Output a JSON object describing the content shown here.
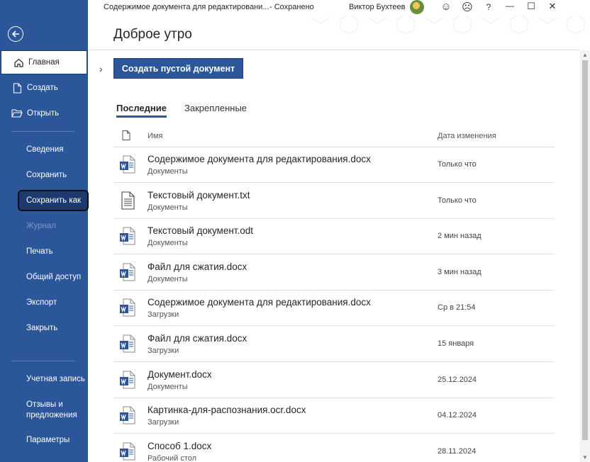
{
  "titlebar": {
    "document_title": "Содержимое документа для редактировани...",
    "status": "-  Сохранено",
    "user_name": "Виктор Бухтеев",
    "icons": [
      "smile-icon",
      "frown-icon",
      "help-icon",
      "minimize-icon",
      "maximize-icon",
      "close-icon"
    ],
    "icon_glyphs": {
      "smile": "☺",
      "frown": "☹",
      "help": "?",
      "minimize": "—",
      "maximize": "☐",
      "close": "✕"
    }
  },
  "greeting": "Доброе утро",
  "sidebar": {
    "back_icon": "back-arrow-icon",
    "home": "Главная",
    "create": "Создать",
    "open": "Открыть",
    "info": "Сведения",
    "save": "Сохранить",
    "save_as": "Сохранить как",
    "history": "Журнал",
    "print": "Печать",
    "share": "Общий доступ",
    "export": "Экспорт",
    "close": "Закрыть",
    "account": "Учетная запись",
    "feedback_line1": "Отзывы и",
    "feedback_line2": "предложения",
    "options": "Параметры"
  },
  "main": {
    "create_blank": "Создать пустой документ",
    "tabs": {
      "recent": "Последние",
      "pinned": "Закрепленные"
    },
    "columns": {
      "name": "Имя",
      "date": "Дата изменения"
    },
    "files": [
      {
        "name": "Содержимое документа для редактирования.docx",
        "location": "Документы",
        "date": "Только что",
        "type": "word"
      },
      {
        "name": "Текстовый документ.txt",
        "location": "Документы",
        "date": "Только что",
        "type": "text"
      },
      {
        "name": "Текстовый документ.odt",
        "location": "Документы",
        "date": "2 мин назад",
        "type": "word"
      },
      {
        "name": "Файл для сжатия.docx",
        "location": "Документы",
        "date": "3 мин назад",
        "type": "word"
      },
      {
        "name": "Содержимое документа для редактирования.docx",
        "location": "Загрузки",
        "date": "Ср в 21:54",
        "type": "word"
      },
      {
        "name": "Файл для сжатия.docx",
        "location": "Загрузки",
        "date": "15 января",
        "type": "word"
      },
      {
        "name": "Документ.docx",
        "location": "Документы",
        "date": "25.12.2024",
        "type": "word"
      },
      {
        "name": "Картинка-для-распознания.ocr.docx",
        "location": "Загрузки",
        "date": "04.12.2024",
        "type": "word"
      },
      {
        "name": "Способ 1.docx",
        "location": "Рабочий стол",
        "date": "28.11.2024",
        "type": "word"
      }
    ]
  },
  "colors": {
    "accent": "#2b579a",
    "sidebar_bg": "#2b579a",
    "highlight_border": "#111111"
  }
}
